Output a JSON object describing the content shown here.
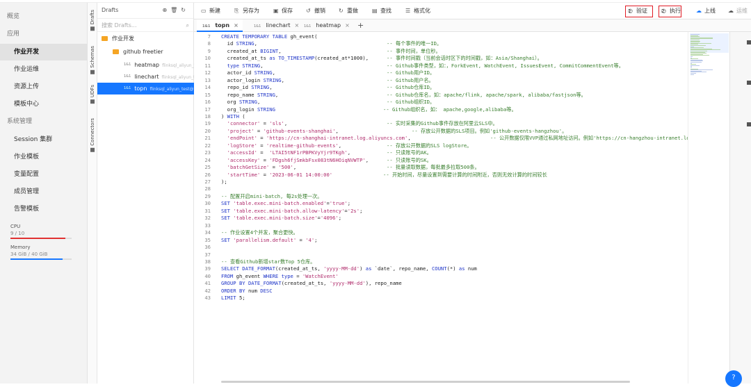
{
  "nav": {
    "items": [
      {
        "label": "概览",
        "type": "sec"
      },
      {
        "label": "应用",
        "type": "sec"
      },
      {
        "label": "作业开发",
        "type": "item",
        "active": true
      },
      {
        "label": "作业运维",
        "type": "item"
      },
      {
        "label": "资源上传",
        "type": "item"
      },
      {
        "label": "模板中心",
        "type": "item"
      },
      {
        "label": "系统管理",
        "type": "sec"
      },
      {
        "label": "Session 集群",
        "type": "item"
      },
      {
        "label": "作业模板",
        "type": "item"
      },
      {
        "label": "变量配置",
        "type": "item"
      },
      {
        "label": "成员管理",
        "type": "item"
      },
      {
        "label": "告警模板",
        "type": "item"
      }
    ],
    "cpu": {
      "label": "CPU",
      "value": "9 / 10",
      "fraction": 0.9,
      "color": "#e03131"
    },
    "memory": {
      "label": "Memory",
      "value": "34 GiB / 40 GiB",
      "fraction": 0.85,
      "color": "#1677ff"
    }
  },
  "vtabs": [
    "Drafts",
    "Schemas",
    "UDFs",
    "Connectors"
  ],
  "tree": {
    "title": "Drafts",
    "search_placeholder": "搜索 Drafts...",
    "nodes": [
      {
        "label": "作业开发",
        "kind": "folder",
        "indent": 0
      },
      {
        "label": "github freetier",
        "kind": "folder",
        "indent": 1
      },
      {
        "label": "heatmap",
        "kind": "file",
        "indent": 2,
        "badge": "1&1",
        "ghost": "flinksql_aliyun_test@pig"
      },
      {
        "label": "linechart",
        "kind": "file",
        "indent": 2,
        "badge": "1&1",
        "ghost": "flinksql_aliyun_test@pig"
      },
      {
        "label": "topn",
        "kind": "file",
        "indent": 2,
        "badge": "1&1",
        "ghost": "flinksql_aliyun_test@pig",
        "selected": true
      }
    ]
  },
  "toolbar": {
    "new": "新建",
    "save_as": "另存为",
    "save": "保存",
    "undo": "撤销",
    "redo": "重做",
    "find": "查找",
    "format": "格式化",
    "validate": "验证",
    "execute": "执行",
    "deploy": "上线",
    "ops": "运维",
    "validate_badge": "1",
    "execute_badge": "2"
  },
  "tabs": [
    {
      "label": "topn",
      "badge": "1&1",
      "active": true
    },
    {
      "label": "linechart",
      "badge": "1&1"
    },
    {
      "label": "heatmap",
      "badge": "1&1"
    }
  ],
  "code_lines": [
    {
      "n": "7",
      "code": "CREATE TEMPORARY TABLE gh_event(",
      "comment": ""
    },
    {
      "n": "8",
      "code": "  id STRING,",
      "comment": "-- 每个事件的唯一ID。"
    },
    {
      "n": "9",
      "code": "  created_at BIGINT,",
      "comment": "-- 事件时间，单位秒。"
    },
    {
      "n": "10",
      "code": "  created_at_ts as TO_TIMESTAMP(created_at*1000),",
      "comment": "-- 事件时间戳（当前会话时区下的时间戳，如：Asia/Shanghai）。"
    },
    {
      "n": "11",
      "code": "  type STRING,",
      "comment": "-- Github事件类型，如：，ForkEvent, WatchEvent, IssuesEvent, CommitCommentEvent等。"
    },
    {
      "n": "12",
      "code": "  actor_id STRING,",
      "comment": "-- Github用户ID。"
    },
    {
      "n": "13",
      "code": "  actor_login STRING,",
      "comment": "-- Github用户名。"
    },
    {
      "n": "14",
      "code": "  repo_id STRING,",
      "comment": "-- Github仓库ID。"
    },
    {
      "n": "15",
      "code": "  repo_name STRING,",
      "comment": "-- Github仓库名，如：apache/flink, apache/spark, alibaba/fastjson等。"
    },
    {
      "n": "16",
      "code": "  org STRING,",
      "comment": "-- Github组织ID。"
    },
    {
      "n": "17",
      "code": "  org_login STRING",
      "comment": "-- Github组织名，如： apache,google,alibaba等。"
    },
    {
      "n": "18",
      "code": ") WITH (",
      "comment": ""
    },
    {
      "n": "19",
      "code": "  'connector' = 'sls',",
      "comment": "-- 实时采集的Github事件存放在阿里云SLS中。"
    },
    {
      "n": "20",
      "code": "  'project' = 'github-events-shanghai',",
      "comment": "-- 存放公开数据的SLS项目。例如'github-events-hangzhou'。"
    },
    {
      "n": "21",
      "code": "  'endPoint' = 'https://cn-shanghai-intranet.log.aliyuncs.com',",
      "comment": "-- 公开数据仅限VVP通过私网地址访问。例如'https://cn-hangzhou-intranet.lo"
    },
    {
      "n": "22",
      "code": "  'logStore' = 'realtime-github-events',",
      "comment": "-- 存放公开数据的SLS logStore。"
    },
    {
      "n": "23",
      "code": "  'accessId' =  'LTAI5tNF1rPBPKVyYjr9TKgh',",
      "comment": "-- 只读账号的AK。"
    },
    {
      "n": "24",
      "code": "  'accessKey' = 'FDgsh6fjSmkbFsx083tN6HOiqNVWTP',",
      "comment": "-- 只读账号的SK。"
    },
    {
      "n": "25",
      "code": "  'batchGetSize' = '500',",
      "comment": "-- 批量读取数据，每批最多拉取500条。"
    },
    {
      "n": "26",
      "code": "  'startTime' = '2023-06-01 14:00:00'",
      "comment": "-- 开始时间，尽量设置到需要计算的时间附近，否则无效计算的时间较长"
    },
    {
      "n": "27",
      "code": ");",
      "comment": ""
    },
    {
      "n": "28",
      "code": "",
      "comment": ""
    },
    {
      "n": "29",
      "code": "-- 配置开启mini-batch, 每2s处理一次。",
      "comment": "",
      "isComment": true
    },
    {
      "n": "30",
      "code": "SET 'table.exec.mini-batch.enabled'='true';",
      "comment": ""
    },
    {
      "n": "31",
      "code": "SET 'table.exec.mini-batch.allow-latency'='2s';",
      "comment": ""
    },
    {
      "n": "32",
      "code": "SET 'table.exec.mini-batch.size'='4096';",
      "comment": ""
    },
    {
      "n": "33",
      "code": "",
      "comment": ""
    },
    {
      "n": "34",
      "code": "-- 作业设置4个并发，聚合更快。",
      "comment": "",
      "isComment": true
    },
    {
      "n": "35",
      "code": "SET 'parallelism.default' = '4';",
      "comment": ""
    },
    {
      "n": "36",
      "code": "",
      "comment": ""
    },
    {
      "n": "37",
      "code": "",
      "comment": ""
    },
    {
      "n": "38",
      "code": "-- 查看Github新增star数Top 5仓库。",
      "comment": "",
      "isComment": true
    },
    {
      "n": "39",
      "code": "SELECT DATE_FORMAT(created_at_ts, 'yyyy-MM-dd') as `date`, repo_name, COUNT(*) as num",
      "comment": ""
    },
    {
      "n": "40",
      "code": "FROM gh_event WHERE type = 'WatchEvent'",
      "comment": ""
    },
    {
      "n": "41",
      "code": "GROUP BY DATE_FORMAT(created_at_ts, 'yyyy-MM-dd'), repo_name",
      "comment": ""
    },
    {
      "n": "42",
      "code": "ORDER BY num DESC",
      "comment": ""
    },
    {
      "n": "43",
      "code": "LIMIT 5;",
      "comment": ""
    }
  ],
  "icons": {
    "new": "new-file-icon",
    "save_as": "save-as-icon",
    "save": "save-icon",
    "undo": "undo-icon",
    "redo": "redo-icon",
    "find": "find-icon",
    "format": "format-icon",
    "validate": "validate-icon",
    "execute": "execute-icon",
    "deploy": "cloud-upload-icon",
    "ops": "ops-icon",
    "fab": "help-icon"
  }
}
